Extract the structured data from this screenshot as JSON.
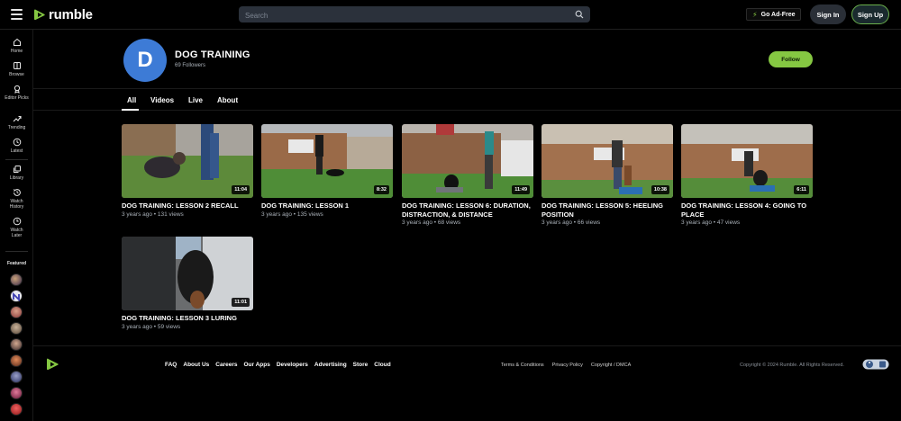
{
  "header": {
    "logo_text": "rumble",
    "search_placeholder": "Search",
    "adfree_label": "Go Ad-Free",
    "signin_label": "Sign In",
    "signup_label": "Sign Up"
  },
  "sidebar": {
    "items": [
      {
        "label": "Home",
        "icon": "home-icon"
      },
      {
        "label": "Browse",
        "icon": "browse-icon"
      },
      {
        "label": "Editor Picks",
        "icon": "editor-picks-icon"
      },
      {
        "label": "Trending",
        "icon": "trending-icon"
      },
      {
        "label": "Latest",
        "icon": "clock-icon"
      },
      {
        "label": "Library",
        "icon": "library-icon"
      },
      {
        "label": "Watch History",
        "icon": "history-icon"
      },
      {
        "label": "Watch Later",
        "icon": "watch-later-icon"
      }
    ],
    "featured_label": "Featured"
  },
  "channel": {
    "avatar_letter": "D",
    "name": "DOG TRAINING",
    "followers": "69 Followers",
    "follow_label": "Follow"
  },
  "tabs": [
    {
      "label": "All",
      "active": true
    },
    {
      "label": "Videos",
      "active": false
    },
    {
      "label": "Live",
      "active": false
    },
    {
      "label": "About",
      "active": false
    }
  ],
  "videos": [
    {
      "title": "DOG TRAINING: LESSON 2 RECALL",
      "meta": "3 years ago • 131 views",
      "duration": "11:04"
    },
    {
      "title": "DOG TRAINING: LESSON 1",
      "meta": "3 years ago • 135 views",
      "duration": "8:32"
    },
    {
      "title": "DOG TRAINING: LESSON 6: DURATION, DISTRACTION, & DISTANCE",
      "meta": "3 years ago • 68 views",
      "duration": "11:49"
    },
    {
      "title": "DOG TRAINING: LESSON 5: HEELING POSITION",
      "meta": "3 years ago • 66 views",
      "duration": "10:38"
    },
    {
      "title": "DOG TRAINING: LESSON 4: GOING TO PLACE",
      "meta": "3 years ago • 47 views",
      "duration": "6:11"
    },
    {
      "title": "DOG TRAINING: LESSON 3 LURING",
      "meta": "3 years ago • 59 views",
      "duration": "11:01"
    }
  ],
  "footer": {
    "links": [
      "FAQ",
      "About Us",
      "Careers",
      "Our Apps",
      "Developers",
      "Advertising",
      "Store",
      "Cloud"
    ],
    "legal": [
      "Terms & Conditions",
      "Privacy Policy",
      "Copyright / DMCA"
    ],
    "copyright": "Copyright © 2024 Rumble. All Rights Reserved."
  },
  "colors": {
    "brand_green": "#85c742",
    "avatar_blue": "#3d7bd6",
    "background": "#000000"
  }
}
